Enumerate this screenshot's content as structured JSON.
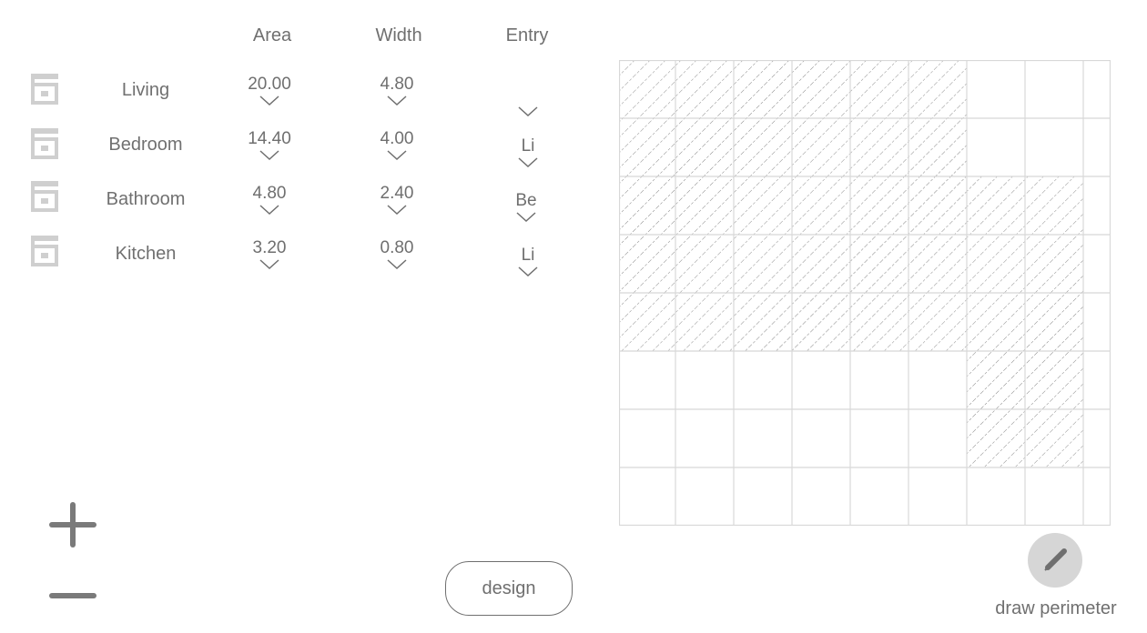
{
  "columns": {
    "area": "Area",
    "width": "Width",
    "entry": "Entry"
  },
  "rooms": [
    {
      "name": "Living",
      "area": "20.00",
      "width": "4.80",
      "entry": ""
    },
    {
      "name": "Bedroom",
      "area": "14.40",
      "width": "4.00",
      "entry": "Li"
    },
    {
      "name": "Bathroom",
      "area": "4.80",
      "width": "2.40",
      "entry": "Be"
    },
    {
      "name": "Kitchen",
      "area": "3.20",
      "width": "0.80",
      "entry": "Li"
    }
  ],
  "icons": {
    "room_icon": "storage-box-icon",
    "add": "plus-icon",
    "remove": "minus-icon",
    "dropdown": "chevron-down-icon",
    "draw": "pencil-icon"
  },
  "buttons": {
    "design": "design",
    "draw_perimeter": "draw perimeter"
  },
  "grid": {
    "columns": 8,
    "rows": 8,
    "hatched_cells": [
      [
        0,
        0
      ],
      [
        0,
        1
      ],
      [
        0,
        2
      ],
      [
        0,
        3
      ],
      [
        0,
        4
      ],
      [
        0,
        5
      ],
      [
        1,
        0
      ],
      [
        1,
        1
      ],
      [
        1,
        2
      ],
      [
        1,
        3
      ],
      [
        1,
        4
      ],
      [
        1,
        5
      ],
      [
        2,
        0
      ],
      [
        2,
        1
      ],
      [
        2,
        2
      ],
      [
        2,
        3
      ],
      [
        2,
        4
      ],
      [
        2,
        5
      ],
      [
        2,
        6
      ],
      [
        2,
        7
      ],
      [
        3,
        0
      ],
      [
        3,
        1
      ],
      [
        3,
        2
      ],
      [
        3,
        3
      ],
      [
        3,
        4
      ],
      [
        3,
        5
      ],
      [
        3,
        6
      ],
      [
        3,
        7
      ],
      [
        4,
        0
      ],
      [
        4,
        1
      ],
      [
        4,
        2
      ],
      [
        4,
        3
      ],
      [
        4,
        4
      ],
      [
        4,
        5
      ],
      [
        4,
        6
      ],
      [
        4,
        7
      ],
      [
        5,
        6
      ],
      [
        5,
        7
      ],
      [
        6,
        6
      ],
      [
        6,
        7
      ]
    ]
  },
  "colors": {
    "text": "#6f6f6f",
    "icon": "#cfcfcf",
    "grid_line": "#d8d8d8",
    "hatch": "#8a8a8a",
    "draw_button_bg": "#d6d6d6"
  }
}
